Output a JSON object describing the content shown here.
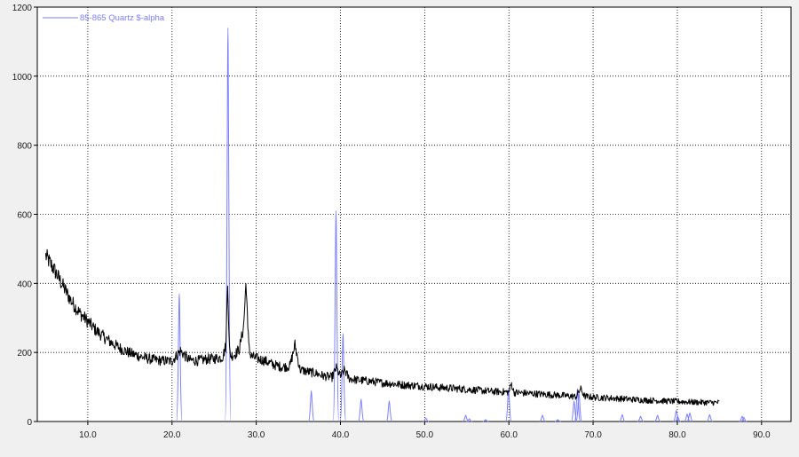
{
  "chart_data": {
    "type": "line",
    "title": "",
    "xlabel": "",
    "ylabel": "",
    "xlim": [
      4.0,
      93.5
    ],
    "ylim": [
      0,
      1200
    ],
    "grid": true,
    "legend_placement": "top-left",
    "x_ticks": [
      {
        "value": 10,
        "label": "10.0"
      },
      {
        "value": 20,
        "label": "20.0"
      },
      {
        "value": 30,
        "label": "30.0"
      },
      {
        "value": 40,
        "label": "40.0"
      },
      {
        "value": 50,
        "label": "50.0"
      },
      {
        "value": 60,
        "label": "60.0"
      },
      {
        "value": 70,
        "label": "70.0"
      },
      {
        "value": 80,
        "label": "80.0"
      },
      {
        "value": 90,
        "label": "90.0"
      }
    ],
    "y_ticks": [
      {
        "value": 0,
        "label": "0"
      },
      {
        "value": 200,
        "label": "200"
      },
      {
        "value": 400,
        "label": "400"
      },
      {
        "value": 600,
        "label": "600"
      },
      {
        "value": 800,
        "label": "800"
      },
      {
        "value": 1000,
        "label": "1000"
      },
      {
        "value": 1200,
        "label": "1200"
      }
    ],
    "legend": [
      {
        "label": "85-865 Quartz $-alpha",
        "series": "reference"
      }
    ],
    "series": [
      {
        "name": "",
        "kind": "measured",
        "color": "#000000",
        "x_start": 5.0,
        "x_end": 85.0,
        "x": [
          5,
          6,
          7,
          8,
          9,
          10,
          11,
          12,
          13,
          14,
          15,
          16,
          17,
          18,
          19,
          20,
          21,
          22,
          23,
          24,
          25,
          26,
          26.4,
          26.6,
          26.8,
          27.0,
          27.5,
          28.0,
          28.5,
          28.8,
          29.0,
          29.3,
          30,
          31,
          32,
          33,
          34,
          34.6,
          35.2,
          36,
          37,
          38,
          39,
          39.5,
          40,
          40.5,
          41,
          42,
          43,
          44,
          45,
          46,
          47,
          48,
          49,
          50,
          52,
          54,
          56,
          58,
          60,
          60.3,
          60.6,
          62,
          64,
          66,
          68,
          68.5,
          69,
          70,
          72,
          74,
          76,
          78,
          80,
          82,
          84,
          85
        ],
        "y": [
          480,
          440,
          395,
          350,
          315,
          290,
          263,
          243,
          225,
          210,
          198,
          190,
          183,
          178,
          176,
          175,
          205,
          178,
          176,
          180,
          182,
          186,
          220,
          415,
          210,
          190,
          195,
          210,
          275,
          410,
          260,
          190,
          183,
          176,
          165,
          158,
          160,
          222,
          150,
          145,
          140,
          132,
          128,
          155,
          130,
          150,
          125,
          120,
          118,
          115,
          112,
          110,
          107,
          105,
          104,
          102,
          98,
          95,
          91,
          87,
          85,
          110,
          84,
          82,
          79,
          76,
          72,
          95,
          73,
          70,
          68,
          65,
          62,
          60,
          58,
          56,
          55,
          55
        ],
        "noise_amplitude": 14
      },
      {
        "name": "85-865 Quartz $-alpha",
        "kind": "reference",
        "color": "#7b7fff",
        "peaks": [
          {
            "x": 20.86,
            "y": 370
          },
          {
            "x": 26.64,
            "y": 1140
          },
          {
            "x": 36.54,
            "y": 90
          },
          {
            "x": 39.47,
            "y": 610
          },
          {
            "x": 40.3,
            "y": 255
          },
          {
            "x": 42.45,
            "y": 65
          },
          {
            "x": 45.79,
            "y": 60
          },
          {
            "x": 50.14,
            "y": 10
          },
          {
            "x": 54.87,
            "y": 18
          },
          {
            "x": 55.3,
            "y": 8
          },
          {
            "x": 57.24,
            "y": 5
          },
          {
            "x": 59.96,
            "y": 95
          },
          {
            "x": 63.99,
            "y": 18
          },
          {
            "x": 65.8,
            "y": 5
          },
          {
            "x": 67.74,
            "y": 60
          },
          {
            "x": 68.14,
            "y": 95
          },
          {
            "x": 68.32,
            "y": 85
          },
          {
            "x": 73.46,
            "y": 20
          },
          {
            "x": 75.64,
            "y": 15
          },
          {
            "x": 77.65,
            "y": 18
          },
          {
            "x": 79.87,
            "y": 32
          },
          {
            "x": 80.04,
            "y": 15
          },
          {
            "x": 81.17,
            "y": 22
          },
          {
            "x": 81.49,
            "y": 25
          },
          {
            "x": 83.84,
            "y": 20
          },
          {
            "x": 87.7,
            "y": 15
          },
          {
            "x": 87.9,
            "y": 12
          }
        ]
      }
    ]
  }
}
